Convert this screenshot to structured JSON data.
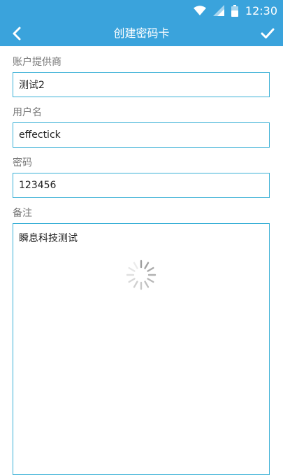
{
  "status_bar": {
    "time": "12:30",
    "icons": [
      "wifi-icon",
      "signal-icon",
      "battery-icon"
    ]
  },
  "toolbar": {
    "title": "创建密码卡",
    "back_icon": "chevron-left-icon",
    "confirm_icon": "check-icon"
  },
  "form": {
    "provider_label": "账户提供商",
    "provider_value": "测试2",
    "username_label": "用户名",
    "username_value": "effectick",
    "password_label": "密码",
    "password_value": "123456",
    "notes_label": "备注",
    "notes_value": "瞬息科技测试"
  },
  "colors": {
    "toolbar_bg": "#3aa3dc",
    "input_border": "#3ab0d6"
  }
}
